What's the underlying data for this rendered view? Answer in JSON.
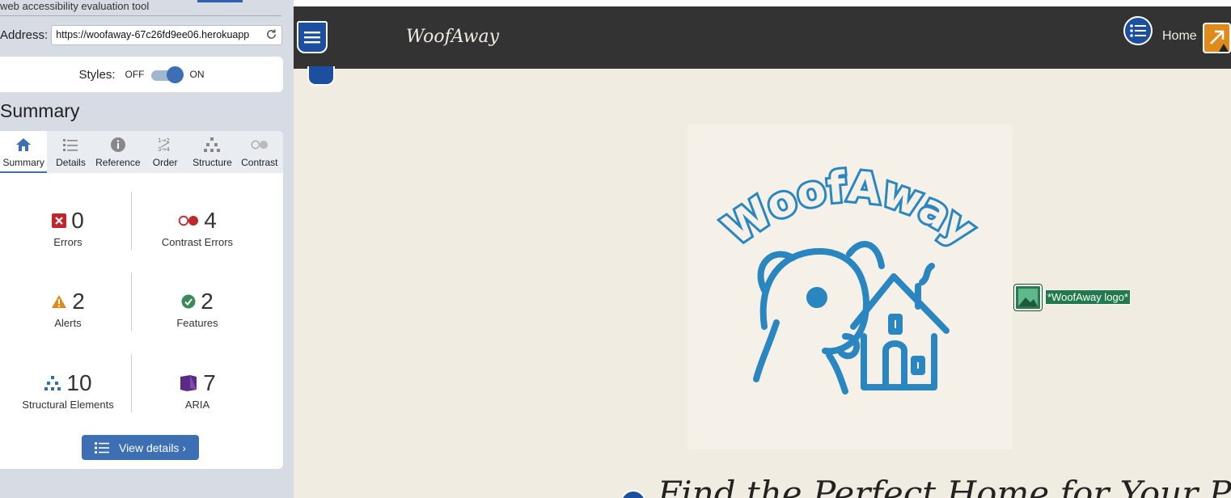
{
  "wave": {
    "tagline": "web accessibility evaluation tool",
    "address_label": "Address:",
    "address_value": "https://woofaway-67c26fd9ee06.herokuapp",
    "styles_label": "Styles:",
    "styles_off": "OFF",
    "styles_on": "ON",
    "styles_enabled": true,
    "summary_heading": "Summary",
    "tabs": [
      {
        "label": "Summary",
        "icon": "home-icon",
        "active": true
      },
      {
        "label": "Details",
        "icon": "list-icon"
      },
      {
        "label": "Reference",
        "icon": "info-icon"
      },
      {
        "label": "Order",
        "icon": "order-icon"
      },
      {
        "label": "Structure",
        "icon": "structure-icon"
      },
      {
        "label": "Contrast",
        "icon": "contrast-icon"
      }
    ],
    "stats": {
      "errors": {
        "count": "0",
        "label": "Errors",
        "icon": "error-icon",
        "color": "#c0272d"
      },
      "contrast": {
        "count": "4",
        "label": "Contrast Errors",
        "icon": "contrast-error-icon",
        "color": "#c0272d"
      },
      "alerts": {
        "count": "2",
        "label": "Alerts",
        "icon": "alert-icon",
        "color": "#e08a1c"
      },
      "features": {
        "count": "2",
        "label": "Features",
        "icon": "feature-icon",
        "color": "#3a8a5a"
      },
      "structural": {
        "count": "10",
        "label": "Structural Elements",
        "icon": "structure-icon",
        "color": "#2f6db4"
      },
      "aria": {
        "count": "7",
        "label": "ARIA",
        "icon": "aria-icon",
        "color": "#5b2a86"
      }
    },
    "view_details_label": "View details ›"
  },
  "site": {
    "brand": "WoofAway",
    "nav_home": "Home",
    "logo_alt": "*WoofAway logo*",
    "hero_heading": "Find the Perfect Home for Your Pup",
    "colors": {
      "navbar": "#333333",
      "background": "#f1ece2",
      "logo_blue": "#2a86c0"
    }
  }
}
